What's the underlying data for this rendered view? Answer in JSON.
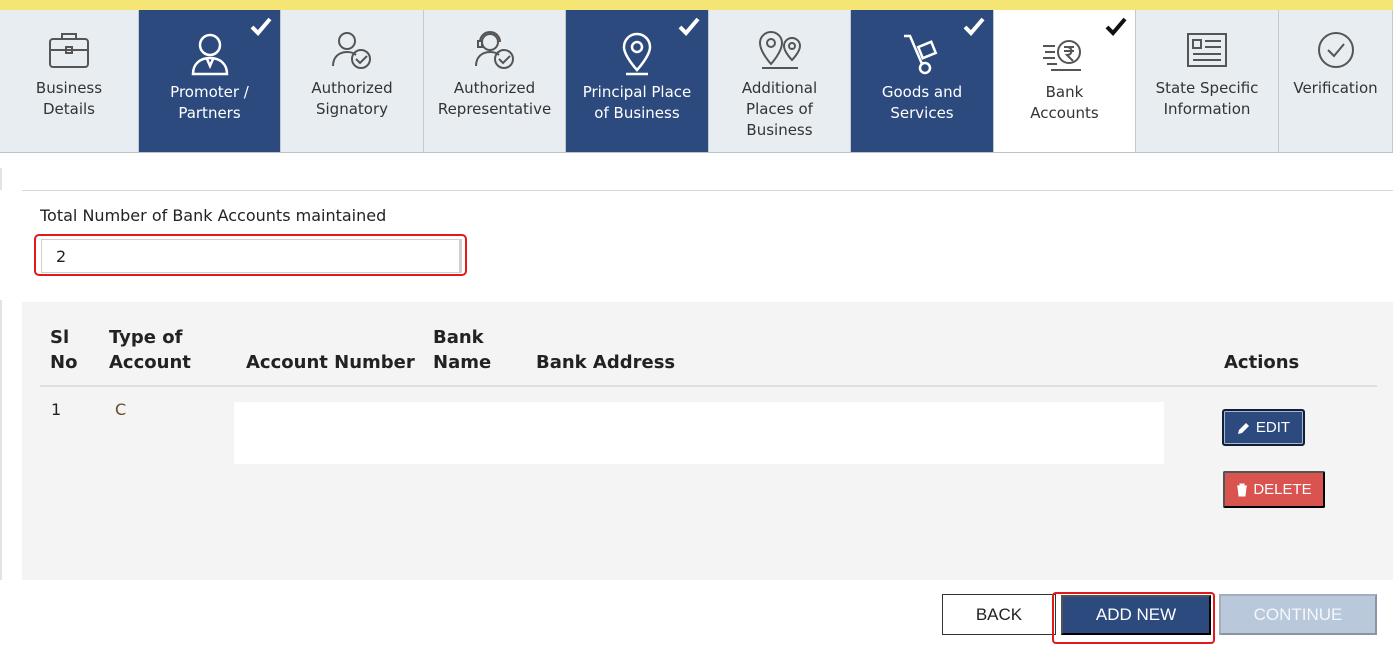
{
  "tabs": [
    {
      "label": "Business\nDetails",
      "icon": "briefcase-icon",
      "state": "default"
    },
    {
      "label": "Promoter /\nPartners",
      "icon": "person-icon",
      "state": "done"
    },
    {
      "label": "Authorized\nSignatory",
      "icon": "user-check-icon",
      "state": "default"
    },
    {
      "label": "Authorized\nRepresentative",
      "icon": "headset-user-check-icon",
      "state": "default"
    },
    {
      "label": "Principal Place\nof Business",
      "icon": "map-pin-icon",
      "state": "done"
    },
    {
      "label": "Additional\nPlaces of\nBusiness",
      "icon": "multi-pin-icon",
      "state": "default"
    },
    {
      "label": "Goods and\nServices",
      "icon": "hand-truck-icon",
      "state": "done"
    },
    {
      "label": "Bank\nAccounts",
      "icon": "rupee-coin-icon",
      "state": "active"
    },
    {
      "label": "State Specific\nInformation",
      "icon": "form-list-icon",
      "state": "default"
    },
    {
      "label": "Verification",
      "icon": "check-circle-icon",
      "state": "default"
    }
  ],
  "bank_count": {
    "label": "Total Number of Bank Accounts maintained",
    "value": "2"
  },
  "table": {
    "headers": {
      "sl_no": "Sl\nNo",
      "type": "Type of\nAccount",
      "account_number": "Account Number",
      "bank_name": "Bank\nName",
      "bank_address": "Bank Address",
      "actions": "Actions"
    },
    "rows": [
      {
        "sl_no": "1",
        "type": "C",
        "account_number": "",
        "bank_name": "",
        "bank_address": ""
      }
    ]
  },
  "row_actions": {
    "edit_label": "EDIT",
    "delete_label": "DELETE"
  },
  "footer": {
    "back_label": "BACK",
    "add_new_label": "ADD NEW",
    "continue_label": "CONTINUE"
  },
  "colors": {
    "brand_navy": "#2c4a7e",
    "tab_default": "#e8edf1",
    "highlight_red": "#e01a1a",
    "delete_red": "#d9534f",
    "disabled_blue": "#b9c8da",
    "top_strip": "#f5e574"
  }
}
